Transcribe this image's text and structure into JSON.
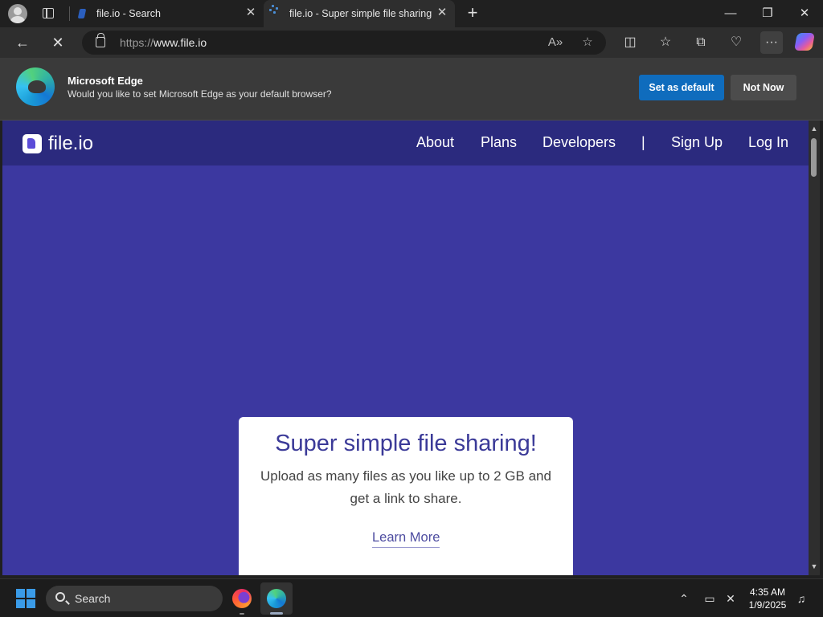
{
  "browser": {
    "tabs": [
      {
        "label": "file.io - Search"
      },
      {
        "label": "file.io - Super simple file sharing"
      }
    ],
    "url_prefix": "https://",
    "url_host": "www.file.io",
    "icons": {
      "back": "←",
      "stop": "✕",
      "read_aloud": "A»",
      "favorite": "☆",
      "split": "◫",
      "favorites": "☆",
      "collections": "⧉",
      "health": "♡",
      "more": "···",
      "minimize": "—",
      "restore": "❐",
      "close": "✕",
      "tab_close": "✕",
      "new_tab": "+"
    }
  },
  "banner": {
    "title": "Microsoft Edge",
    "text": "Would you like to set Microsoft Edge as your default browser?",
    "set_default": "Set as default",
    "not_now": "Not Now"
  },
  "site": {
    "name": "file.io",
    "nav": [
      "About",
      "Plans",
      "Developers",
      "|",
      "Sign Up",
      "Log In"
    ],
    "hero": {
      "title": "Super simple file sharing!",
      "text": "Upload as many files as you like up to 2 GB and get a link to share.",
      "link": "Learn More"
    },
    "colors": {
      "nav": "#2b2a7e",
      "background": "#3c38a0",
      "accent": "#3b3a98"
    }
  },
  "taskbar": {
    "search": "Search",
    "time": "4:35 AM",
    "date": "1/9/2025",
    "tray_icons": [
      "chevron-up",
      "network",
      "volume-muted",
      "notifications"
    ]
  }
}
